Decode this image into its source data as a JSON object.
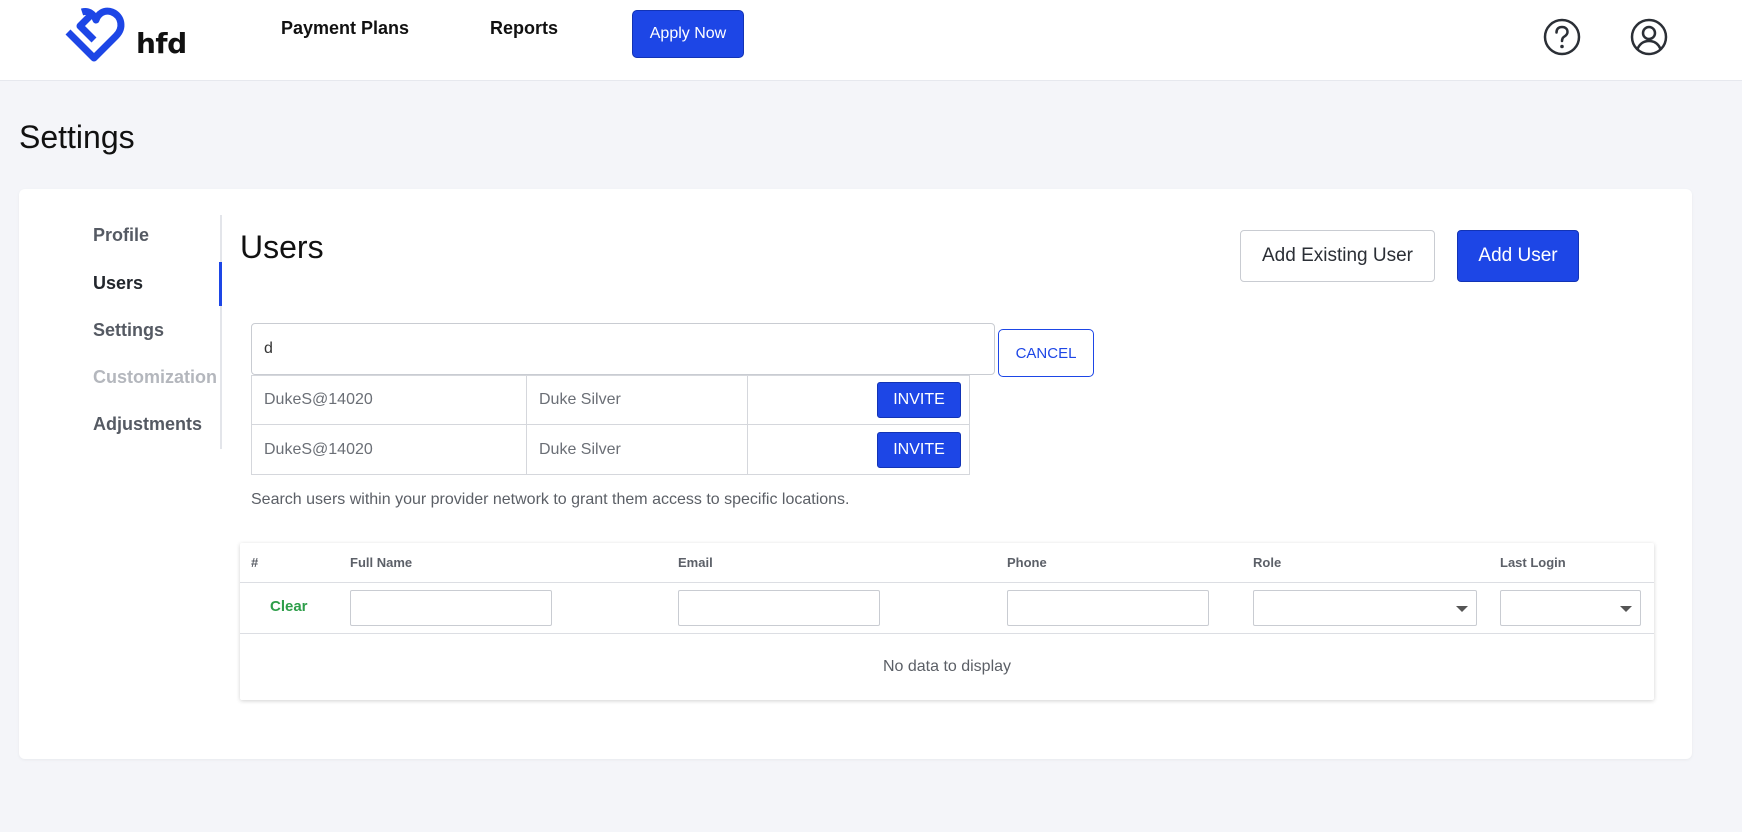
{
  "header": {
    "logo_text": "hfd",
    "nav": [
      {
        "label": "Payment Plans"
      },
      {
        "label": "Reports"
      }
    ],
    "apply_label": "Apply Now",
    "help_icon": "help-circle-icon",
    "user_icon": "user-circle-icon"
  },
  "page": {
    "title": "Settings"
  },
  "sidebar": {
    "items": [
      {
        "label": "Profile",
        "state": "default"
      },
      {
        "label": "Users",
        "state": "active"
      },
      {
        "label": "Settings",
        "state": "default"
      },
      {
        "label": "Customization",
        "state": "disabled"
      },
      {
        "label": "Adjustments",
        "state": "default"
      }
    ]
  },
  "users": {
    "title": "Users",
    "add_existing_label": "Add Existing User",
    "add_user_label": "Add User",
    "search": {
      "value": "d",
      "cancel_label": "CANCEL"
    },
    "results": [
      {
        "username": "DukeS@14020",
        "name": "Duke Silver",
        "action": "INVITE"
      },
      {
        "username": "DukeS@14020",
        "name": "Duke Silver",
        "action": "INVITE"
      }
    ],
    "helper_text": "Search users within your provider network to grant them access to specific locations."
  },
  "grid": {
    "columns": [
      "#",
      "Full Name",
      "Email",
      "Phone",
      "Role",
      "Last Login"
    ],
    "clear_label": "Clear",
    "empty_text": "No data to display"
  },
  "colors": {
    "primary": "#1d46e6",
    "clear_green": "#2e9e4a",
    "background": "#f4f5f9"
  }
}
